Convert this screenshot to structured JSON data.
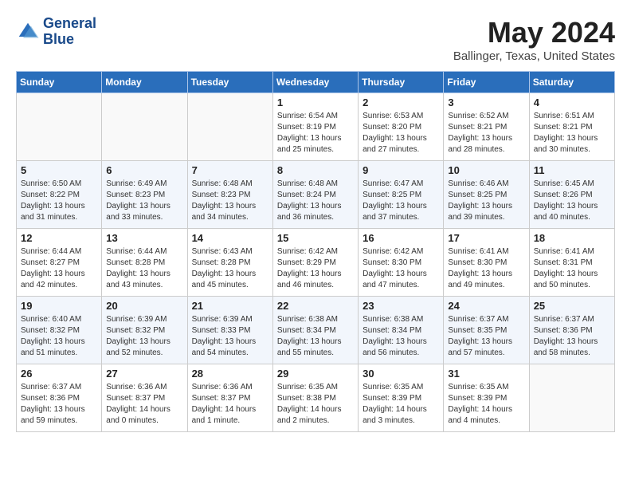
{
  "header": {
    "logo_line1": "General",
    "logo_line2": "Blue",
    "month_year": "May 2024",
    "location": "Ballinger, Texas, United States"
  },
  "weekdays": [
    "Sunday",
    "Monday",
    "Tuesday",
    "Wednesday",
    "Thursday",
    "Friday",
    "Saturday"
  ],
  "weeks": [
    [
      {
        "day": "",
        "sunrise": "",
        "sunset": "",
        "daylight": ""
      },
      {
        "day": "",
        "sunrise": "",
        "sunset": "",
        "daylight": ""
      },
      {
        "day": "",
        "sunrise": "",
        "sunset": "",
        "daylight": ""
      },
      {
        "day": "1",
        "sunrise": "Sunrise: 6:54 AM",
        "sunset": "Sunset: 8:19 PM",
        "daylight": "Daylight: 13 hours and 25 minutes."
      },
      {
        "day": "2",
        "sunrise": "Sunrise: 6:53 AM",
        "sunset": "Sunset: 8:20 PM",
        "daylight": "Daylight: 13 hours and 27 minutes."
      },
      {
        "day": "3",
        "sunrise": "Sunrise: 6:52 AM",
        "sunset": "Sunset: 8:21 PM",
        "daylight": "Daylight: 13 hours and 28 minutes."
      },
      {
        "day": "4",
        "sunrise": "Sunrise: 6:51 AM",
        "sunset": "Sunset: 8:21 PM",
        "daylight": "Daylight: 13 hours and 30 minutes."
      }
    ],
    [
      {
        "day": "5",
        "sunrise": "Sunrise: 6:50 AM",
        "sunset": "Sunset: 8:22 PM",
        "daylight": "Daylight: 13 hours and 31 minutes."
      },
      {
        "day": "6",
        "sunrise": "Sunrise: 6:49 AM",
        "sunset": "Sunset: 8:23 PM",
        "daylight": "Daylight: 13 hours and 33 minutes."
      },
      {
        "day": "7",
        "sunrise": "Sunrise: 6:48 AM",
        "sunset": "Sunset: 8:23 PM",
        "daylight": "Daylight: 13 hours and 34 minutes."
      },
      {
        "day": "8",
        "sunrise": "Sunrise: 6:48 AM",
        "sunset": "Sunset: 8:24 PM",
        "daylight": "Daylight: 13 hours and 36 minutes."
      },
      {
        "day": "9",
        "sunrise": "Sunrise: 6:47 AM",
        "sunset": "Sunset: 8:25 PM",
        "daylight": "Daylight: 13 hours and 37 minutes."
      },
      {
        "day": "10",
        "sunrise": "Sunrise: 6:46 AM",
        "sunset": "Sunset: 8:25 PM",
        "daylight": "Daylight: 13 hours and 39 minutes."
      },
      {
        "day": "11",
        "sunrise": "Sunrise: 6:45 AM",
        "sunset": "Sunset: 8:26 PM",
        "daylight": "Daylight: 13 hours and 40 minutes."
      }
    ],
    [
      {
        "day": "12",
        "sunrise": "Sunrise: 6:44 AM",
        "sunset": "Sunset: 8:27 PM",
        "daylight": "Daylight: 13 hours and 42 minutes."
      },
      {
        "day": "13",
        "sunrise": "Sunrise: 6:44 AM",
        "sunset": "Sunset: 8:28 PM",
        "daylight": "Daylight: 13 hours and 43 minutes."
      },
      {
        "day": "14",
        "sunrise": "Sunrise: 6:43 AM",
        "sunset": "Sunset: 8:28 PM",
        "daylight": "Daylight: 13 hours and 45 minutes."
      },
      {
        "day": "15",
        "sunrise": "Sunrise: 6:42 AM",
        "sunset": "Sunset: 8:29 PM",
        "daylight": "Daylight: 13 hours and 46 minutes."
      },
      {
        "day": "16",
        "sunrise": "Sunrise: 6:42 AM",
        "sunset": "Sunset: 8:30 PM",
        "daylight": "Daylight: 13 hours and 47 minutes."
      },
      {
        "day": "17",
        "sunrise": "Sunrise: 6:41 AM",
        "sunset": "Sunset: 8:30 PM",
        "daylight": "Daylight: 13 hours and 49 minutes."
      },
      {
        "day": "18",
        "sunrise": "Sunrise: 6:41 AM",
        "sunset": "Sunset: 8:31 PM",
        "daylight": "Daylight: 13 hours and 50 minutes."
      }
    ],
    [
      {
        "day": "19",
        "sunrise": "Sunrise: 6:40 AM",
        "sunset": "Sunset: 8:32 PM",
        "daylight": "Daylight: 13 hours and 51 minutes."
      },
      {
        "day": "20",
        "sunrise": "Sunrise: 6:39 AM",
        "sunset": "Sunset: 8:32 PM",
        "daylight": "Daylight: 13 hours and 52 minutes."
      },
      {
        "day": "21",
        "sunrise": "Sunrise: 6:39 AM",
        "sunset": "Sunset: 8:33 PM",
        "daylight": "Daylight: 13 hours and 54 minutes."
      },
      {
        "day": "22",
        "sunrise": "Sunrise: 6:38 AM",
        "sunset": "Sunset: 8:34 PM",
        "daylight": "Daylight: 13 hours and 55 minutes."
      },
      {
        "day": "23",
        "sunrise": "Sunrise: 6:38 AM",
        "sunset": "Sunset: 8:34 PM",
        "daylight": "Daylight: 13 hours and 56 minutes."
      },
      {
        "day": "24",
        "sunrise": "Sunrise: 6:37 AM",
        "sunset": "Sunset: 8:35 PM",
        "daylight": "Daylight: 13 hours and 57 minutes."
      },
      {
        "day": "25",
        "sunrise": "Sunrise: 6:37 AM",
        "sunset": "Sunset: 8:36 PM",
        "daylight": "Daylight: 13 hours and 58 minutes."
      }
    ],
    [
      {
        "day": "26",
        "sunrise": "Sunrise: 6:37 AM",
        "sunset": "Sunset: 8:36 PM",
        "daylight": "Daylight: 13 hours and 59 minutes."
      },
      {
        "day": "27",
        "sunrise": "Sunrise: 6:36 AM",
        "sunset": "Sunset: 8:37 PM",
        "daylight": "Daylight: 14 hours and 0 minutes."
      },
      {
        "day": "28",
        "sunrise": "Sunrise: 6:36 AM",
        "sunset": "Sunset: 8:37 PM",
        "daylight": "Daylight: 14 hours and 1 minute."
      },
      {
        "day": "29",
        "sunrise": "Sunrise: 6:35 AM",
        "sunset": "Sunset: 8:38 PM",
        "daylight": "Daylight: 14 hours and 2 minutes."
      },
      {
        "day": "30",
        "sunrise": "Sunrise: 6:35 AM",
        "sunset": "Sunset: 8:39 PM",
        "daylight": "Daylight: 14 hours and 3 minutes."
      },
      {
        "day": "31",
        "sunrise": "Sunrise: 6:35 AM",
        "sunset": "Sunset: 8:39 PM",
        "daylight": "Daylight: 14 hours and 4 minutes."
      },
      {
        "day": "",
        "sunrise": "",
        "sunset": "",
        "daylight": ""
      }
    ]
  ]
}
